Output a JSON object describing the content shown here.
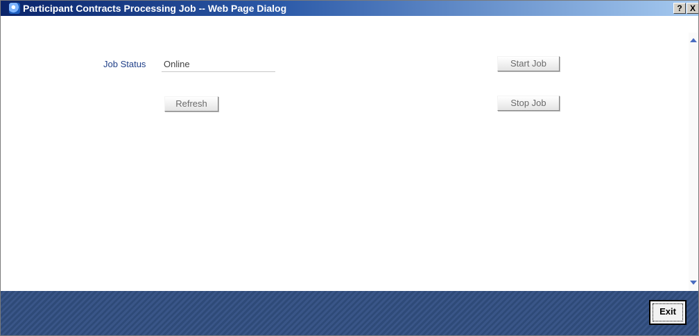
{
  "window": {
    "title": "Participant Contracts Processing Job -- Web Page Dialog",
    "help_label": "?",
    "close_label": "X"
  },
  "form": {
    "job_status_label": "Job Status",
    "job_status_value": "Online"
  },
  "buttons": {
    "start_job": "Start Job",
    "stop_job": "Stop Job",
    "refresh": "Refresh",
    "exit": "Exit"
  },
  "icons": {
    "title_icon": "ie-icon",
    "scroll_up": "scroll-up-arrow",
    "scroll_down": "scroll-down-arrow"
  },
  "colors": {
    "titlebar_start": "#0a246a",
    "titlebar_end": "#a6caf0",
    "label": "#1f3f88",
    "footer": "#2e4a78"
  }
}
